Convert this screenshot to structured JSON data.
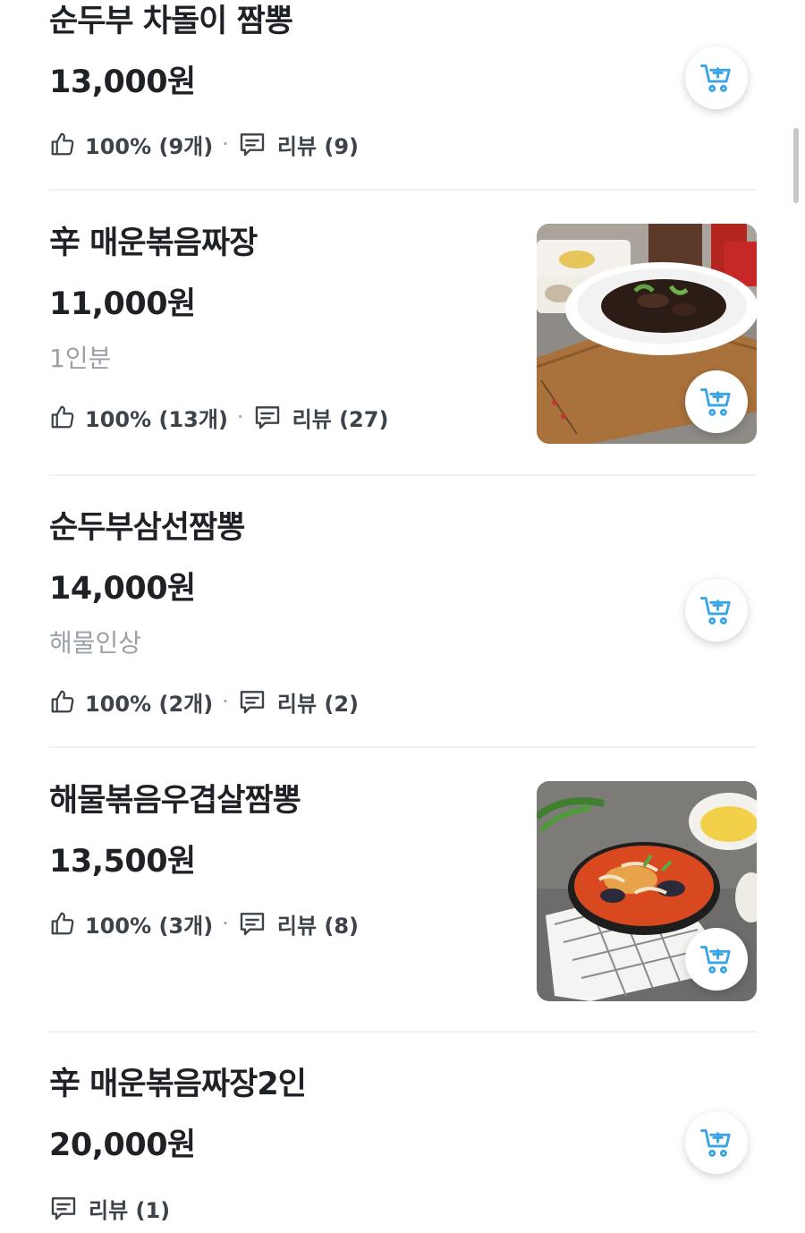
{
  "colors": {
    "accent": "#3aa5e6",
    "text": "#1e2227",
    "muted": "#9aa1a9",
    "divider": "#f0f1f3"
  },
  "icons": {
    "like": "thumbs-up-icon",
    "review": "speech-bubble-icon",
    "cart": "add-to-cart-icon"
  },
  "menu_items": [
    {
      "name": "순두부 차돌이 짬뽕",
      "price": "13,000원",
      "like": "100% (9개)",
      "separator": "·",
      "review": "리뷰 (9)"
    },
    {
      "name": "辛 매운볶음짜장",
      "price": "11,000원",
      "desc": "1인분",
      "like": "100% (13개)",
      "separator": "·",
      "review": "리뷰 (27)"
    },
    {
      "name": "순두부삼선짬뽕",
      "price": "14,000원",
      "desc": "해물인상",
      "like": "100% (2개)",
      "separator": "·",
      "review": "리뷰 (2)"
    },
    {
      "name": "해물볶음우겹살짬뽕",
      "price": "13,500원",
      "like": "100% (3개)",
      "separator": "·",
      "review": "리뷰 (8)"
    },
    {
      "name": "辛 매운볶음짜장2인",
      "price": "20,000원",
      "review": "리뷰 (1)"
    }
  ]
}
